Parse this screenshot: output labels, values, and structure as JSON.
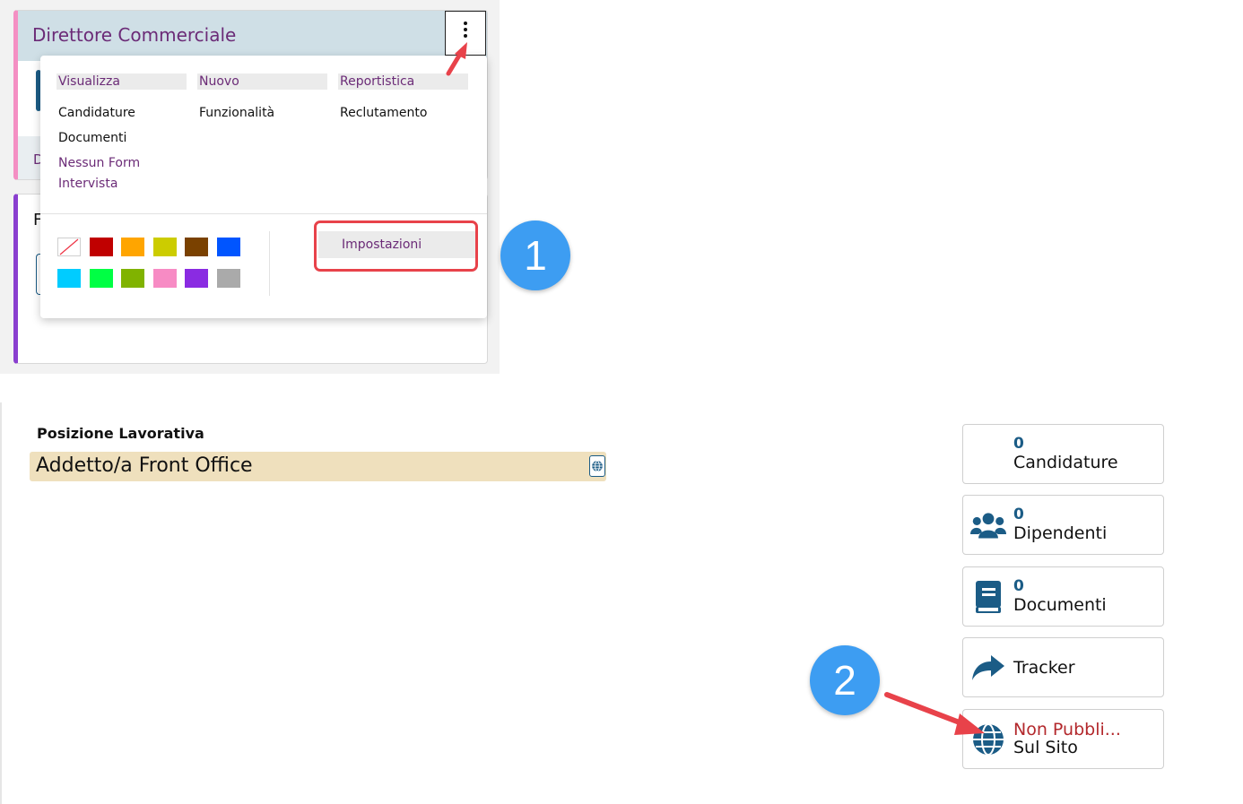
{
  "top": {
    "card_title": "Direttore Commerciale",
    "card1_letter": "D",
    "card2_letter": "F",
    "menu": {
      "columns": [
        {
          "header": "Visualizza",
          "items": [
            "Candidature",
            "Documenti"
          ],
          "extra": [
            "Nessun Form",
            "Intervista"
          ]
        },
        {
          "header": "Nuovo",
          "items": [
            "Funzionalità"
          ]
        },
        {
          "header": "Reportistica",
          "items": [
            "Reclutamento"
          ]
        }
      ],
      "colors": [
        "#ffffff",
        "#c00000",
        "#ffa500",
        "#cccc00",
        "#7a4100",
        "#0055ff",
        "#00ccff",
        "#00ff44",
        "#80b300",
        "#f78bc4",
        "#8a2be2",
        "#aaaaaa"
      ],
      "settings_label": "Impostazioni"
    }
  },
  "badges": {
    "one": "1",
    "two": "2"
  },
  "position": {
    "label": "Posizione Lavorativa",
    "value": "Addetto/a Front Office"
  },
  "side_buttons": {
    "candidature": {
      "count": "0",
      "label": "Candidature"
    },
    "dipendenti": {
      "count": "0",
      "label": "Dipendenti",
      "icon": "users-icon"
    },
    "documenti": {
      "count": "0",
      "label": "Documenti",
      "icon": "book-icon"
    },
    "tracker": {
      "label": "Tracker",
      "icon": "share-icon"
    },
    "pubblicazione": {
      "status": "Non Pubbli...",
      "label": "Sul Sito",
      "icon": "globe-icon"
    }
  },
  "colors": {
    "accent": "#1b5c86",
    "menu_text": "#6b2b77",
    "badge": "#3d9df2",
    "annotation": "#e8424a"
  }
}
